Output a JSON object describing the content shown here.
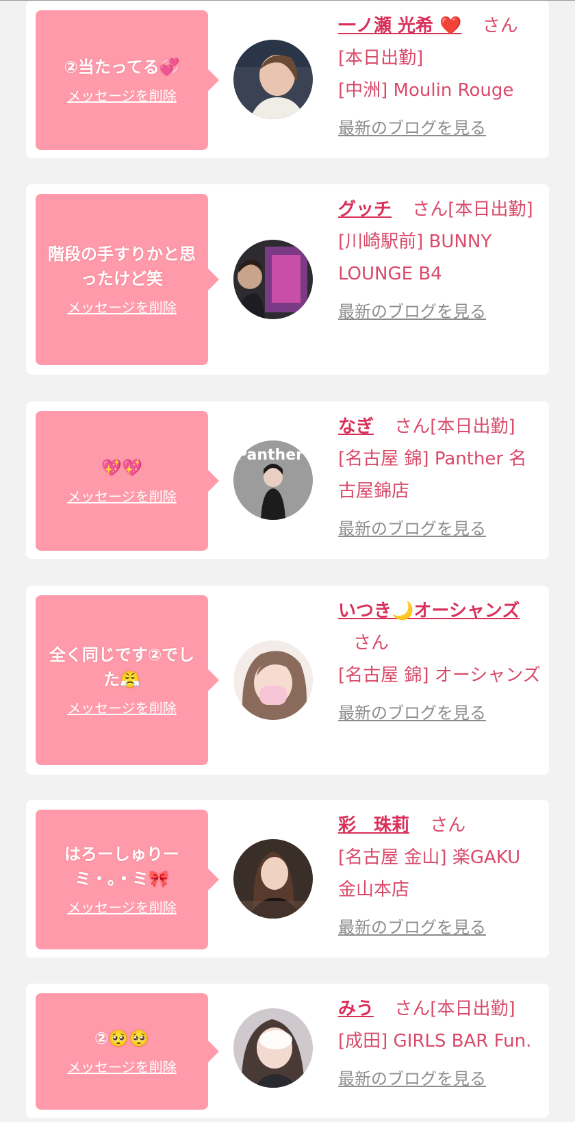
{
  "cards": [
    {
      "message": "②当たってる💞",
      "delete_label": "メッセージを削除",
      "name": "一ノ瀬 光希 ❤️",
      "san": "さん",
      "status": "[本日出勤]",
      "shop": "[中洲] Moulin Rouge",
      "blog_label": "最新のブログを見る",
      "avatar_icon": "profile-photo"
    },
    {
      "message": "階段の手すりかと思ったけど笑",
      "delete_label": "メッセージを削除",
      "name": "グッチ",
      "san": "さん",
      "status": "[本日出勤]",
      "shop": "[川崎駅前] BUNNY LOUNGE B4",
      "blog_label": "最新のブログを見る",
      "avatar_icon": "profile-photo"
    },
    {
      "message": "💖💖",
      "delete_label": "メッセージを削除",
      "name": "なぎ",
      "san": "さん",
      "status": "[本日出勤]",
      "shop": "[名古屋 錦] Panther 名古屋錦店",
      "blog_label": "最新のブログを見る",
      "avatar_icon": "profile-photo",
      "avatar_text": "Panther"
    },
    {
      "message": "全く同じです②でした😤",
      "delete_label": "メッセージを削除",
      "name": "いつき🌙オーシャンズ",
      "san": "さん",
      "status": "",
      "shop": "[名古屋 錦] オーシャンズ",
      "blog_label": "最新のブログを見る",
      "avatar_icon": "profile-photo"
    },
    {
      "message": "はろーしゅりーミ・。・ミ🎀",
      "delete_label": "メッセージを削除",
      "name": "彩　珠莉",
      "san": "さん",
      "status": "",
      "shop": "[名古屋 金山] 楽GAKU 金山本店",
      "blog_label": "最新のブログを見る",
      "avatar_icon": "profile-photo"
    },
    {
      "message": "②🥺🥺",
      "delete_label": "メッセージを削除",
      "name": "みう",
      "san": "さん",
      "status": "[本日出勤]",
      "shop": "[成田] GIRLS BAR Fun.",
      "blog_label": "最新のブログを見る",
      "avatar_icon": "profile-photo"
    }
  ],
  "colors": {
    "background": "#f2f2f2",
    "card": "#ffffff",
    "bubble": "#ff9aaa",
    "name": "#d9305a",
    "info": "#d94a6a",
    "blog_link": "#8c8c8c"
  }
}
